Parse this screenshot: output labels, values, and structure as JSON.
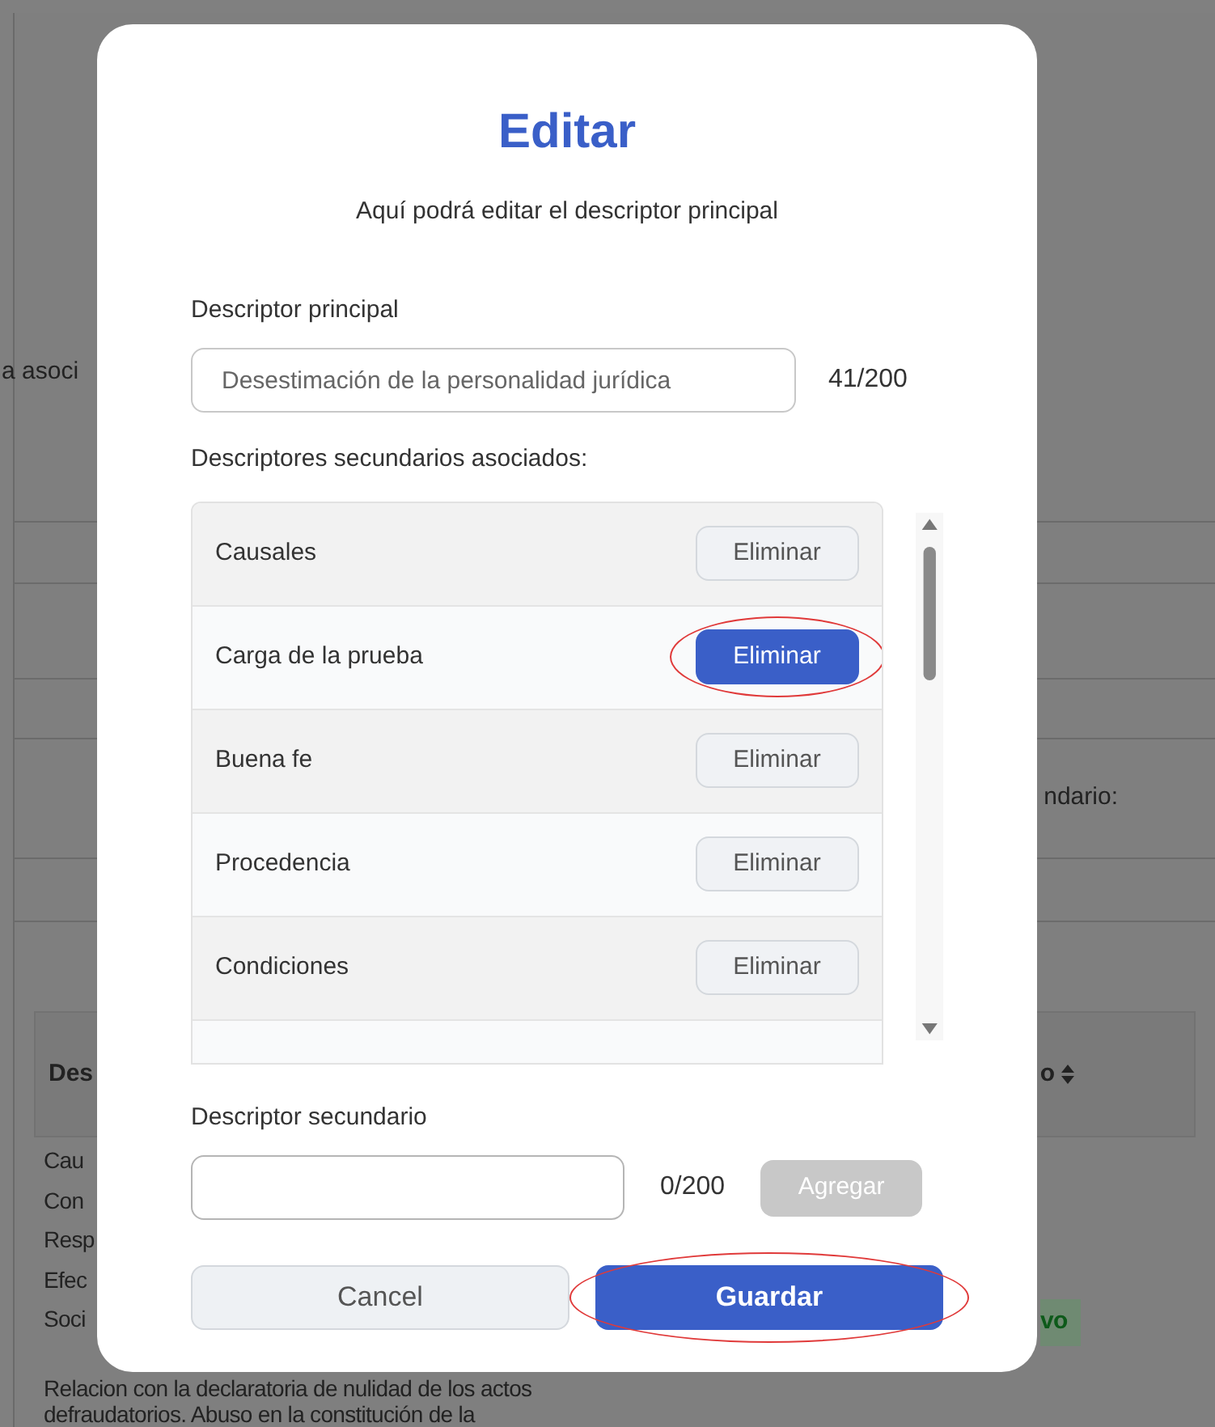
{
  "background": {
    "left_label": "a asoci",
    "right_label": "ndario:",
    "table": {
      "column_1": "Des",
      "column_2": "o",
      "rows": [
        "Cau",
        "Con",
        "Resp",
        "Efec",
        "Soci"
      ],
      "badge": "vo",
      "continued_lines": [
        "Relacion con la declaratoria de nulidad de los actos",
        "defraudatorios. Abuso en la constitución de la"
      ]
    }
  },
  "dialog": {
    "title": "Editar",
    "subtitle": "Aquí podrá editar el descriptor principal",
    "main_field": {
      "label": "Descriptor principal",
      "value": "Desestimación de la personalidad jurídica",
      "counter": "41/200"
    },
    "list_label": "Descriptores secundarios asociados:",
    "items": [
      {
        "name": "Causales",
        "button": "Eliminar",
        "highlighted": false,
        "circled": false
      },
      {
        "name": "Carga de la prueba",
        "button": "Eliminar",
        "highlighted": true,
        "circled": true
      },
      {
        "name": "Buena fe",
        "button": "Eliminar",
        "highlighted": false,
        "circled": false
      },
      {
        "name": "Procedencia",
        "button": "Eliminar",
        "highlighted": false,
        "circled": false
      },
      {
        "name": "Condiciones",
        "button": "Eliminar",
        "highlighted": false,
        "circled": false
      }
    ],
    "secondary_field": {
      "label": "Descriptor secundario",
      "counter": "0/200",
      "add_button": "Agregar",
      "add_disabled": true
    },
    "cancel_button": "Cancel",
    "save_button": {
      "label": "Guardar",
      "circled": true
    }
  }
}
